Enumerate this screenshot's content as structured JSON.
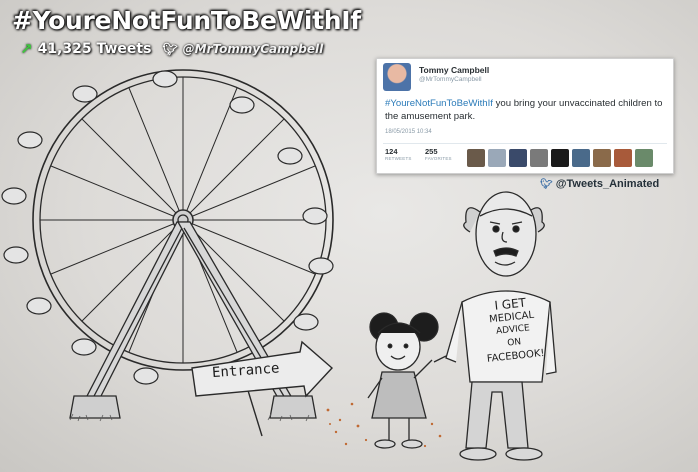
{
  "header": {
    "hashtag": "#YoureNotFunToBeWithIf",
    "tweet_count": "41,325 Tweets",
    "handle": "@MrTommyCampbell",
    "trend_icon": "trending-arrow-icon",
    "bird_icon": "twitter-bird-icon"
  },
  "tweet": {
    "name": "Tommy Campbell",
    "username": "@MrTommyCampbell",
    "hashtag": "#YoureNotFunToBeWithIf",
    "text": " you bring your unvaccinated children to the amusement park.",
    "date": "18/05/2015 10:34",
    "retweets_count": "124",
    "retweets_label": "RETWEETS",
    "favorites_count": "255",
    "favorites_label": "FAVORITES",
    "link_color": "#2b7bb9"
  },
  "credit": {
    "handle": "@Tweets_Animated"
  },
  "drawing": {
    "sign_text": "Entrance",
    "shirt_lines": [
      "I GET",
      "MEDICAL",
      "ADVICE",
      "ON",
      "FACEBOOK!"
    ]
  }
}
